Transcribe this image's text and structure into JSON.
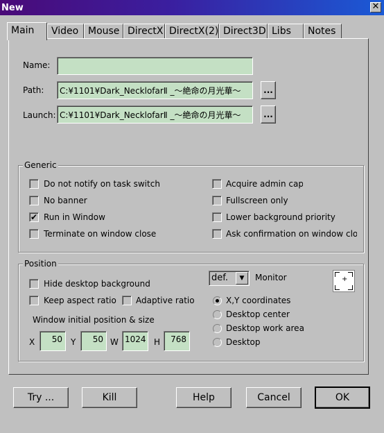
{
  "window": {
    "title": "New",
    "close_glyph": "✕"
  },
  "tabs": [
    {
      "label": "Main"
    },
    {
      "label": "Video"
    },
    {
      "label": "Mouse"
    },
    {
      "label": "DirectX"
    },
    {
      "label": "DirectX(2)"
    },
    {
      "label": "Direct3D"
    },
    {
      "label": "Libs"
    },
    {
      "label": "Notes"
    }
  ],
  "active_tab": "Main",
  "main": {
    "name_label": "Name:",
    "name_value": "",
    "path_label": "Path:",
    "path_value": "C:¥1101¥Dark_NecklofarⅡ _〜絶命の月光華〜",
    "launch_label": "Launch:",
    "launch_value": "C:¥1101¥Dark_NecklofarⅡ _〜絶命の月光華〜",
    "browse_label": "..."
  },
  "generic": {
    "title": "Generic",
    "options": [
      {
        "label": "Do not notify on task switch",
        "checked": false
      },
      {
        "label": "No banner",
        "checked": false
      },
      {
        "label": "Run in Window",
        "checked": true
      },
      {
        "label": "Terminate on window close",
        "checked": false
      },
      {
        "label": "Acquire admin caps",
        "checked": false
      },
      {
        "label": "Fullscreen only",
        "checked": false
      },
      {
        "label": "Lower background priority",
        "checked": false
      },
      {
        "label": "Ask confirmation on window close",
        "checked": false
      }
    ]
  },
  "position": {
    "title": "Position",
    "hide_desktop_bg": {
      "label": "Hide desktop background",
      "checked": false
    },
    "keep_aspect": {
      "label": "Keep aspect ratio",
      "checked": false
    },
    "adaptive_ratio": {
      "label": "Adaptive ratio",
      "checked": false
    },
    "window_pos_label": "Window initial position & size",
    "x_label": "X",
    "x_value": "50",
    "y_label": "Y",
    "y_value": "50",
    "w_label": "W",
    "w_value": "1024",
    "h_label": "H",
    "h_value": "768",
    "monitor_select": "def.",
    "monitor_label": "Monitor",
    "monitor_icon": "crosshair-icon",
    "radios": [
      {
        "label": "X,Y coordinates",
        "selected": true
      },
      {
        "label": "Desktop center",
        "selected": false
      },
      {
        "label": "Desktop work area",
        "selected": false
      },
      {
        "label": "Desktop",
        "selected": false
      }
    ]
  },
  "buttons": {
    "try": "Try ...",
    "kill": "Kill",
    "help": "Help",
    "cancel": "Cancel",
    "ok": "OK"
  }
}
